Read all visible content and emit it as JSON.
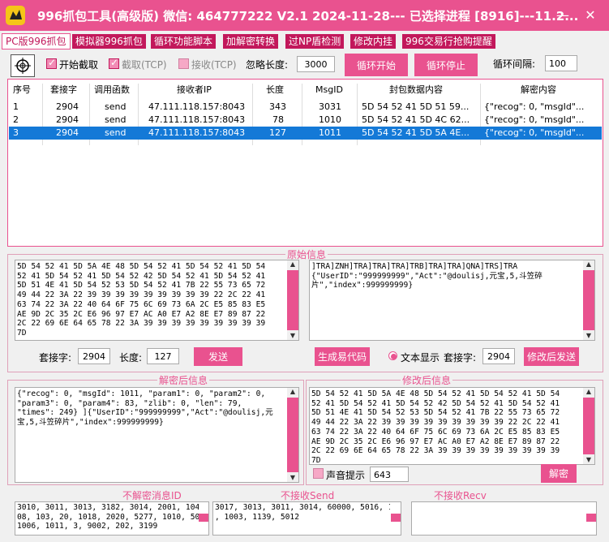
{
  "title": {
    "text": "996抓包工具(高级版)  微信: 464777222   V2.1   2024-11-28--- 已选择进程 [8916]---11.2...",
    "minimize": "—",
    "close": "✕"
  },
  "tabs": [
    "PC版996抓包",
    "模拟器996抓包",
    "循环功能脚本",
    "加解密转换",
    "过NP盾检测",
    "修改内挂",
    "996交易行抢购提醒"
  ],
  "toolbar": {
    "start_capture": "开始截取",
    "capture_tcp": "截取(TCP)",
    "recv_tcp": "接收(TCP)",
    "ignore_len_label": "忽略长度:",
    "ignore_len_value": "3000",
    "loop_start": "循环开始",
    "loop_stop": "循环停止",
    "loop_interval_label": "循环间隔:",
    "loop_interval_value": "100"
  },
  "table": {
    "headers": [
      "序号",
      "套接字",
      "调用函数",
      "接收者IP",
      "长度",
      "MsgID",
      "封包数据内容",
      "解密内容"
    ],
    "rows": [
      [
        "1",
        "2904",
        "send",
        "47.111.118.157:8043",
        "343",
        "3031",
        "5D 54 52 41 5D 51 59...",
        "{\"recog\": 0, \"msgId\"..."
      ],
      [
        "2",
        "2904",
        "send",
        "47.111.118.157:8043",
        "78",
        "1010",
        "5D 54 52 41 5D 4C 62...",
        "{\"recog\": 0, \"msgId\"..."
      ],
      [
        "3",
        "2904",
        "send",
        "47.111.118.157:8043",
        "127",
        "1011",
        "5D 54 52 41 5D 5A 4E...",
        "{\"recog\": 0, \"msgId\"..."
      ]
    ]
  },
  "raw": {
    "title": "原始信息",
    "hex": "5D 54 52 41 5D 5A 4E 48 5D 54 52 41 5D 54 52 41 5D 54\n52 41 5D 54 52 41 5D 54 52 42 5D 54 52 41 5D 54 52 41\n5D 51 4E 41 5D 54 52 53 5D 54 52 41 7B 22 55 73 65 72\n49 44 22 3A 22 39 39 39 39 39 39 39 39 39 22 2C 22 41\n63 74 22 3A 22 40 64 6F 75 6C 69 73 6A 2C E5 85 83 E5\nAE 9D 2C 35 2C E6 96 97 E7 AC A0 E7 A2 8E E7 89 87 22\n2C 22 69 6E 64 65 78 22 3A 39 39 39 39 39 39 39 39 39\n7D",
    "text": "]TRA]ZNH]TRA]TRA]TRA]TRB]TRA]TRA]QNA]TRS]TRA\n{\"UserID\":\"999999999\",\"Act\":\"@doulisj,元宝,5,斗笠碎\n片\",\"index\":999999999}",
    "socket_label": "套接字:",
    "socket_value": "2904",
    "length_label": "长度:",
    "length_value": "127",
    "send": "发送",
    "gen_code": "生成易代码",
    "text_display": "文本显示",
    "socket2_label": "套接字:",
    "socket2_value": "2904",
    "send_modified": "修改后发送"
  },
  "decrypted": {
    "title": "解密后信息",
    "text": "{\"recog\": 0, \"msgId\": 1011, \"param1\": 0, \"param2\": 0,\n\"param3\": 0, \"param4\": 83, \"zlib\": 0, \"len\": 79,\n\"times\": 249} ]{\"UserID\":\"999999999\",\"Act\":\"@doulisj,元\n宝,5,斗笠碎片\",\"index\":999999999}"
  },
  "modified": {
    "title": "修改后信息",
    "hex": "5D 54 52 41 5D 5A 4E 48 5D 54 52 41 5D 54 52 41 5D 54\n52 41 5D 54 52 41 5D 54 52 42 5D 54 52 41 5D 54 52 41\n5D 51 4E 41 5D 54 52 53 5D 54 52 41 7B 22 55 73 65 72\n49 44 22 3A 22 39 39 39 39 39 39 39 39 39 22 2C 22 41\n63 74 22 3A 22 40 64 6F 75 6C 69 73 6A 2C E5 85 83 E5\nAE 9D 2C 35 2C E6 96 97 E7 AC A0 E7 A2 8E E7 89 87 22\n2C 22 69 6E 64 65 78 22 3A 39 39 39 39 39 39 39 39 39\n7D",
    "sound_label": "声音提示",
    "sound_value": "643",
    "decrypt": "解密"
  },
  "no_decrypt": {
    "title": "不解密消息ID",
    "text": "3010, 3011, 3013, 3182, 3014, 2001, 104, 1\n08, 103, 20, 1018, 2020, 5277, 1010, 5012,\n1006, 1011, 3, 9002, 202, 3199"
  },
  "no_send": {
    "title": "不接收Send",
    "text": "3017, 3013, 3011, 3014, 60000, 5016, 1001\n, 1003, 1139, 5012"
  },
  "no_recv": {
    "title": "不接收Recv",
    "text": ""
  }
}
